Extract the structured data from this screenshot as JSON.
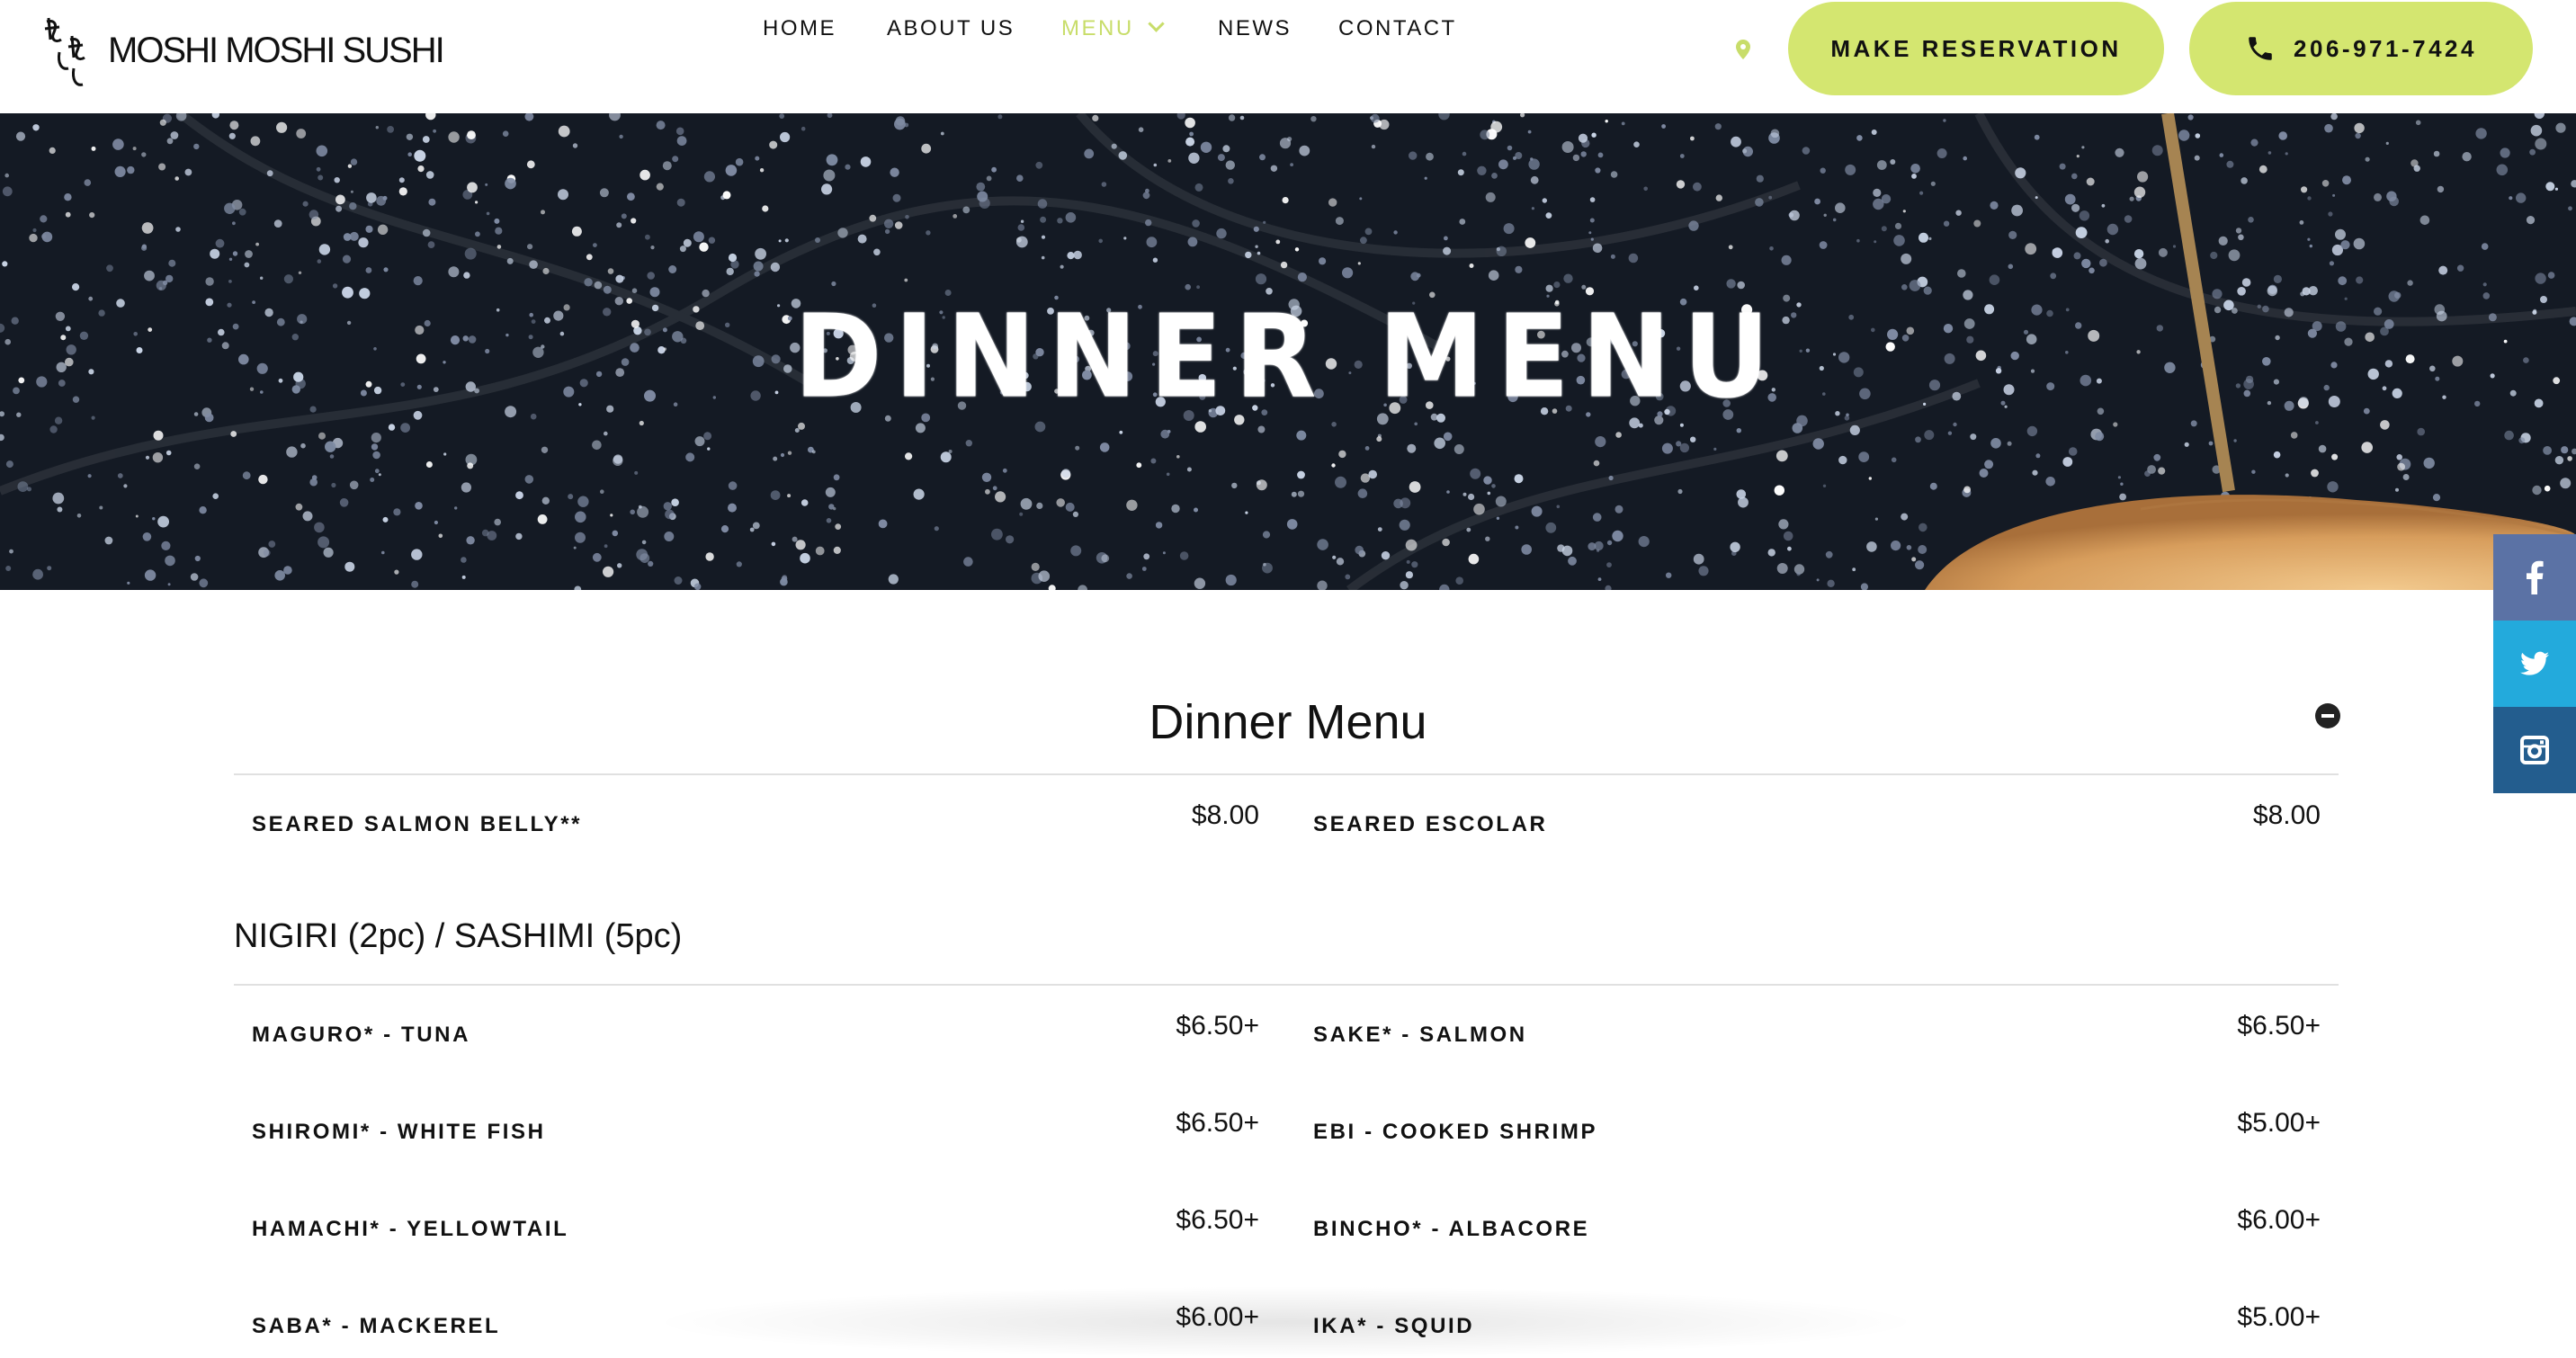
{
  "header": {
    "logo_text": "MOSHI MOSHI SUSHI",
    "nav": [
      {
        "label": "HOME"
      },
      {
        "label": "ABOUT US"
      },
      {
        "label": "MENU"
      },
      {
        "label": "NEWS"
      },
      {
        "label": "CONTACT"
      }
    ],
    "active_nav": "MENU",
    "reserve_label": "MAKE RESERVATION",
    "phone_label": "206-971-7424",
    "accent_color": "#d4e670"
  },
  "hero": {
    "title": "DINNER MENU"
  },
  "social": [
    "facebook-icon",
    "twitter-icon",
    "instagram-icon"
  ],
  "menu": {
    "title": "Dinner Menu",
    "top_items": [
      {
        "name": "SEARED SALMON BELLY**",
        "price": "$8.00"
      },
      {
        "name": "SEARED ESCOLAR",
        "price": "$8.00"
      }
    ],
    "section": {
      "title": "NIGIRI (2pc) / SASHIMI (5pc)",
      "items": [
        {
          "name": "MAGURO* - TUNA",
          "price": "$6.50+"
        },
        {
          "name": "SAKE* - SALMON",
          "price": "$6.50+"
        },
        {
          "name": "SHIROMI* - WHITE FISH",
          "price": "$6.50+"
        },
        {
          "name": "EBI - COOKED SHRIMP",
          "price": "$5.00+"
        },
        {
          "name": "HAMACHI* - YELLOWTAIL",
          "price": "$6.50+"
        },
        {
          "name": "BINCHO* - ALBACORE",
          "price": "$6.00+"
        },
        {
          "name": "SABA* - MACKEREL",
          "price": "$6.00+"
        },
        {
          "name": "IKA* - SQUID",
          "price": "$5.00+"
        }
      ]
    }
  }
}
